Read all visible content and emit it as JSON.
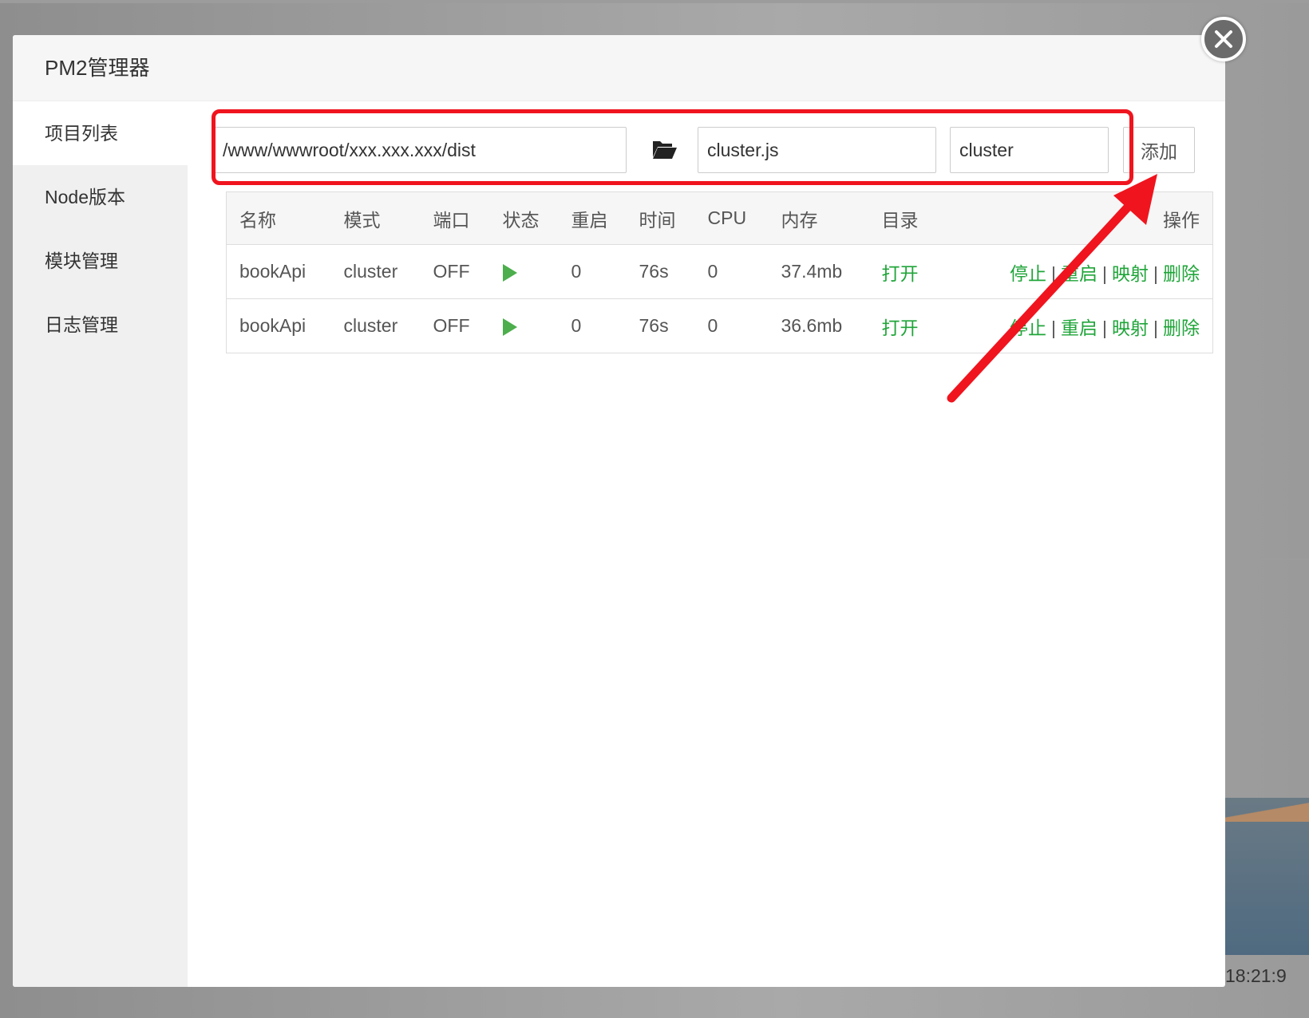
{
  "modal": {
    "title": "PM2管理器"
  },
  "sidebar": {
    "items": [
      {
        "label": "项目列表"
      },
      {
        "label": "Node版本"
      },
      {
        "label": "模块管理"
      },
      {
        "label": "日志管理"
      }
    ]
  },
  "form": {
    "path": "/www/wwwroot/xxx.xxx.xxx/dist",
    "script": "cluster.js",
    "name": "cluster",
    "add_label": "添加"
  },
  "table": {
    "headers": [
      "名称",
      "模式",
      "端口",
      "状态",
      "重启",
      "时间",
      "CPU",
      "内存",
      "目录",
      "操作"
    ],
    "rows": [
      {
        "name": "bookApi",
        "mode": "cluster",
        "port": "OFF",
        "restart": "0",
        "time": "76s",
        "cpu": "0",
        "memory": "37.4mb",
        "dir": "打开"
      },
      {
        "name": "bookApi",
        "mode": "cluster",
        "port": "OFF",
        "restart": "0",
        "time": "76s",
        "cpu": "0",
        "memory": "36.6mb",
        "dir": "打开"
      }
    ],
    "actions": {
      "stop": "停止",
      "restart": "重启",
      "map": "映射",
      "delete": "删除",
      "sep": "|"
    }
  },
  "background": {
    "axis_label": "18:21:9"
  },
  "colors": {
    "accent": "#20a53a",
    "annotation": "#f0141e"
  }
}
